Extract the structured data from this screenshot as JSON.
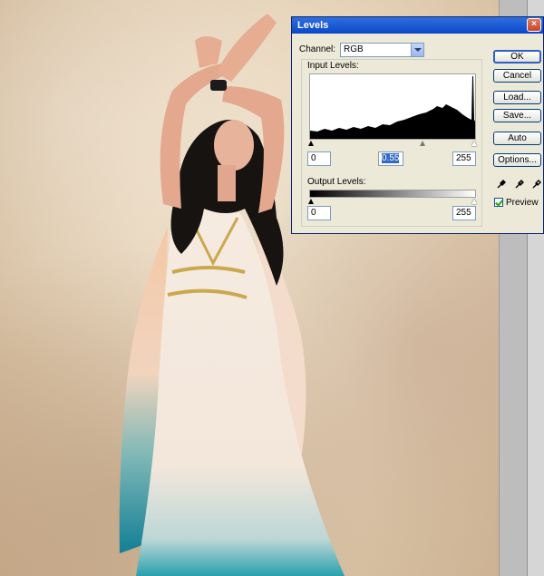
{
  "dialog": {
    "title": "Levels",
    "channel_label": "Channel:",
    "channel_value": "RGB",
    "input_levels_label": "Input Levels:",
    "input_black": "0",
    "input_gamma": "0.55",
    "input_white": "255",
    "output_levels_label": "Output Levels:",
    "output_black": "0",
    "output_white": "255",
    "buttons": {
      "ok": "OK",
      "cancel": "Cancel",
      "load": "Load...",
      "save": "Save...",
      "auto": "Auto",
      "options": "Options..."
    },
    "preview_label": "Preview",
    "preview_checked": true
  },
  "icons": [
    "close-icon",
    "black-eyedropper-icon",
    "gray-eyedropper-icon",
    "white-eyedropper-icon"
  ],
  "colors": {
    "title_bar": "#0a48c8",
    "dialog_bg": "#ece9d8"
  }
}
